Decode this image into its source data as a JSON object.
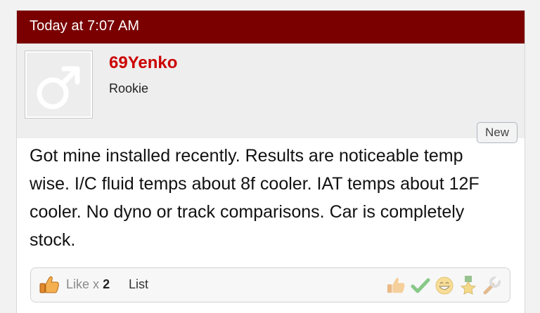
{
  "post": {
    "timestamp": "Today at 7:07 AM",
    "username": "69Yenko",
    "user_title": "Rookie",
    "badge": "New",
    "message": "Got mine installed recently. Results are noticeable temp wise. I/C fluid temps about 8f cooler. IAT temps about 12F cooler. No dyno or track comparisons. Car is completely stock."
  },
  "footer": {
    "like_label": "Like",
    "like_times": "x",
    "like_count": "2",
    "list_label": "List",
    "rating_icons": [
      "like-icon",
      "agree-icon",
      "funny-icon",
      "winner-icon",
      "informative-icon"
    ]
  },
  "colors": {
    "header_bg": "#7a0000",
    "username": "#cc0000",
    "userbar_bg": "#eeeeee"
  }
}
